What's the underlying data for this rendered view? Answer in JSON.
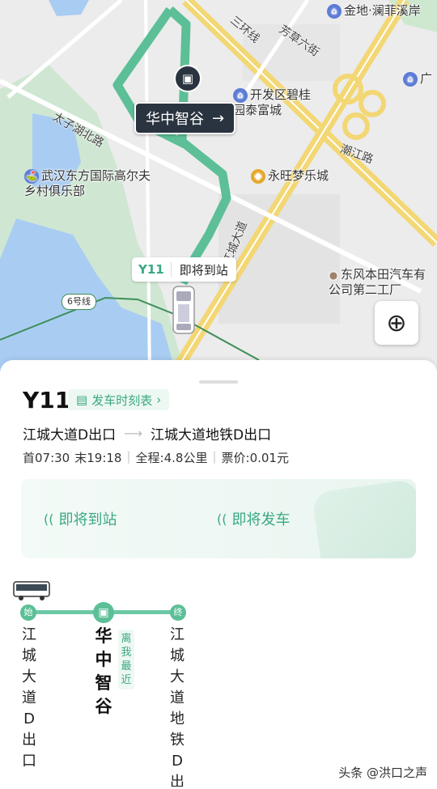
{
  "map": {
    "labels": {
      "poi_jindi": "金地·澜菲溪岸",
      "road_sanhuan": "三环线",
      "road_fangcao": "芳草六街",
      "poi_kaifaqu": "开发区碧桂园泰富城",
      "poi_guang": "广",
      "road_taizihu": "太子湖北路",
      "road_chaojiang": "潮江路",
      "poi_golf": "武汉东方国际高尔夫乡村俱乐部",
      "poi_yongwang": "永旺梦乐城",
      "road_jiangcheng": "江城大道",
      "poi_dongfeng": "东风本田汽车有公司第二工厂",
      "metro_line": "6号线"
    },
    "destination_chip": {
      "label": "华中智谷",
      "arrow": "→"
    },
    "vehicle_tag": {
      "route": "Y11",
      "status": "即将到站"
    },
    "locate_icon": "crosshair-icon",
    "colors": {
      "route_line": "#5cbf97",
      "water": "#a9cdf2",
      "green": "#cde8cf",
      "highway": "#f3d774"
    }
  },
  "sheet": {
    "route_no": "Y11",
    "timetable_label": "发车时刻表",
    "from": "江城大道D出口",
    "to": "江城大道地铁D出口",
    "first_bus": "首07:30",
    "last_bus": "末19:18",
    "distance": "全程:4.8公里",
    "fare": "票价:0.01元",
    "status_arriving": "即将到站",
    "status_departing": "即将发车",
    "accent_color": "#3aa882"
  },
  "strip": {
    "start_badge": "始",
    "end_badge": "终",
    "stop1": "江城大道D出口",
    "stop2": "华中智谷",
    "stop3": "江城大道地铁D出",
    "nearest_tag": "离我最近"
  },
  "watermark": "头条 @洪口之声"
}
